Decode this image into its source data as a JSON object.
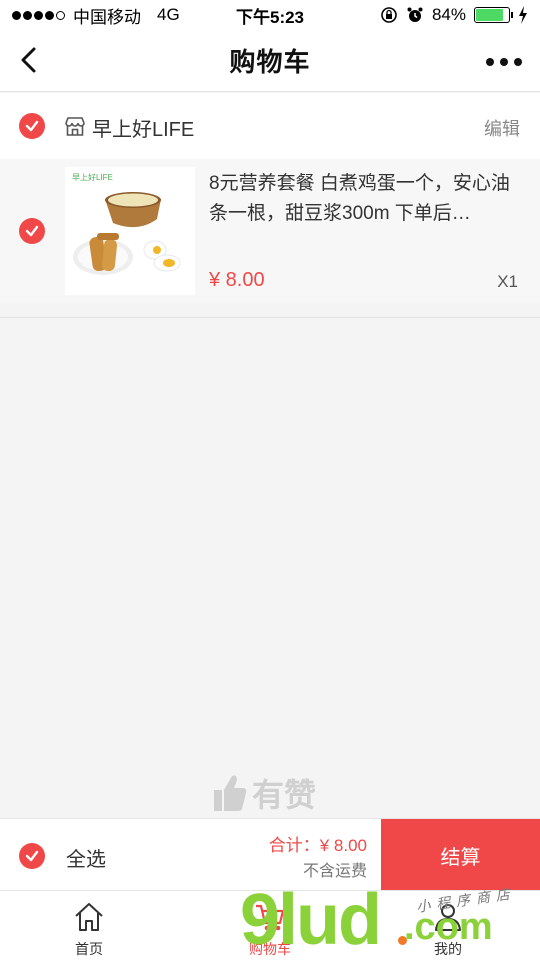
{
  "status": {
    "carrier": "中国移动",
    "network": "4G",
    "time": "下午5:23",
    "battery": "84%",
    "battery_level": 0.84
  },
  "nav": {
    "title": "购物车"
  },
  "shop": {
    "name": "早上好LIFE",
    "edit_label": "编辑"
  },
  "item": {
    "thumb_brand": "早上好LIFE",
    "title": "8元营养套餐 白煮鸡蛋一个，安心油条一根，甜豆浆300m 下单后…",
    "price": "¥ 8.00",
    "qty": "X1"
  },
  "watermark": {
    "youzan": "有赞"
  },
  "footer": {
    "select_all": "全选",
    "total": "合计：¥ 8.00",
    "shipping_note": "不含运费",
    "checkout_label": "结算"
  },
  "tabs": [
    {
      "label": "首页",
      "icon": "home-icon"
    },
    {
      "label": "购物车",
      "icon": "cart-icon"
    },
    {
      "label": "我的",
      "icon": "user-icon"
    }
  ],
  "site_watermark": {
    "main": "9lud",
    "suffix": ".com",
    "script": "小程序商店"
  },
  "colors": {
    "accent": "#f04848",
    "battery": "#4cd964"
  }
}
